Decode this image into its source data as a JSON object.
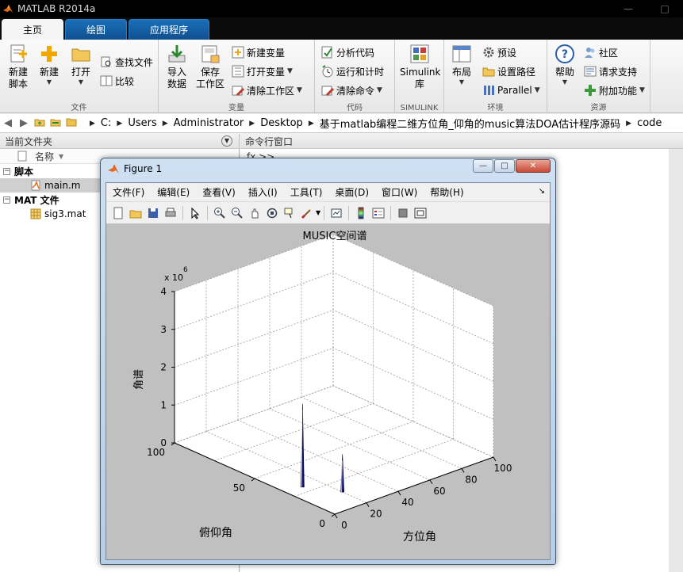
{
  "window": {
    "title": "MATLAB R2014a"
  },
  "tabs": [
    {
      "label": "主页",
      "active": true
    },
    {
      "label": "绘图",
      "active": false
    },
    {
      "label": "应用程序",
      "active": false
    }
  ],
  "ribbon": {
    "file_group": {
      "label": "文件",
      "new_script": "新建\n脚本",
      "new": "新建",
      "open": "打开",
      "find_files": "查找文件",
      "compare": "比较"
    },
    "variable_group": {
      "label": "变量",
      "import_data": "导入\n数据",
      "save_workspace": "保存\n工作区",
      "new_variable": "新建变量",
      "open_variable": "打开变量",
      "clear_workspace": "清除工作区"
    },
    "code_group": {
      "label": "代码",
      "analyze_code": "分析代码",
      "run_and_time": "运行和计时",
      "clear_commands": "清除命令"
    },
    "simulink_group": {
      "label": "SIMULINK",
      "simulink_library": "Simulink\n库"
    },
    "environment_group": {
      "label": "环境",
      "layout": "布局",
      "preferences": "预设",
      "set_path": "设置路径",
      "parallel": "Parallel"
    },
    "resources_group": {
      "label": "资源",
      "help": "帮助",
      "community": "社区",
      "request_support": "请求支持",
      "add_ons": "附加功能"
    }
  },
  "address_bar": {
    "path": [
      "C:",
      "Users",
      "Administrator",
      "Desktop",
      "基于matlab编程二维方位角_仰角的music算法DOA估计程序源码",
      "code"
    ]
  },
  "current_folder": {
    "title": "当前文件夹",
    "column_name": "名称",
    "groups": [
      {
        "label": "脚本",
        "files": [
          "main.m"
        ]
      },
      {
        "label": "MAT 文件",
        "files": [
          "sig3.mat"
        ]
      }
    ]
  },
  "command_window": {
    "title": "命令行窗口",
    "prompt": "fx >>"
  },
  "figure": {
    "title": "Figure 1",
    "menus": [
      "文件(F)",
      "编辑(E)",
      "查看(V)",
      "插入(I)",
      "工具(T)",
      "桌面(D)",
      "窗口(W)",
      "帮助(H)"
    ],
    "toolbar_icons": [
      "new-figure-icon",
      "open-file-icon",
      "save-icon",
      "print-icon",
      "pointer-icon",
      "zoom-in-icon",
      "zoom-out-icon",
      "pan-icon",
      "rotate-3d-icon",
      "data-cursor-icon",
      "brush-icon",
      "link-plot-icon",
      "colorbar-icon",
      "legend-icon",
      "hide-plot-tools-icon",
      "show-plot-tools-icon"
    ]
  },
  "chart_data": {
    "type": "surface",
    "title": "MUSIC空间谱",
    "xlabel": "方位角",
    "ylabel": "俯仰角",
    "zlabel": "角谱",
    "z_exponent_label": "x 10",
    "z_exponent": "6",
    "x_ticks": [
      "0",
      "20",
      "40",
      "60",
      "80",
      "100"
    ],
    "y_ticks": [
      "0",
      "50",
      "100"
    ],
    "z_ticks": [
      "0",
      "1",
      "2",
      "3",
      "4"
    ],
    "xlim": [
      0,
      100
    ],
    "ylim": [
      0,
      100
    ],
    "zlim": [
      0,
      4000000
    ],
    "grid": true,
    "surface_color": "#0a0a7a",
    "peaks": [
      {
        "x": 10,
        "y": 30,
        "z": 2200000
      },
      {
        "x": 20,
        "y": 15,
        "z": 1000000
      }
    ]
  }
}
